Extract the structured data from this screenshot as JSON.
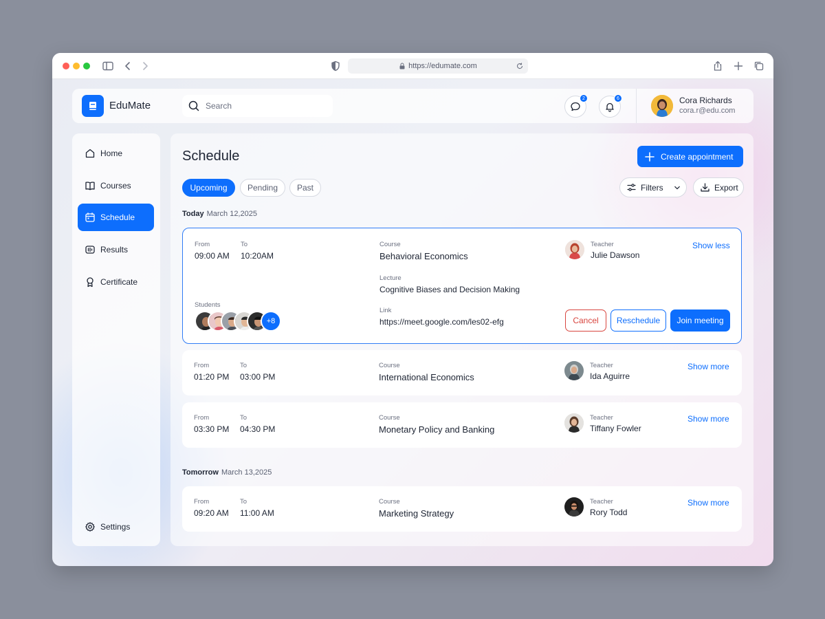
{
  "browser": {
    "url": "https://edumate.com"
  },
  "header": {
    "brand": "EduMate",
    "search_placeholder": "Search",
    "messages_badge": "2",
    "notifications_badge": "6",
    "user": {
      "name": "Cora Richards",
      "email": "cora.r@edu.com"
    }
  },
  "sidebar": {
    "items": [
      {
        "label": "Home",
        "icon": "home-icon",
        "active": false
      },
      {
        "label": "Courses",
        "icon": "book-icon",
        "active": false
      },
      {
        "label": "Schedule",
        "icon": "calendar-icon",
        "active": true
      },
      {
        "label": "Results",
        "icon": "results-icon",
        "active": false
      },
      {
        "label": "Certificate",
        "icon": "certificate-icon",
        "active": false
      }
    ],
    "settings_label": "Settings"
  },
  "main": {
    "title": "Schedule",
    "create_label": "Create appointment",
    "tabs": [
      {
        "label": "Upcoming",
        "active": true
      },
      {
        "label": "Pending",
        "active": false
      },
      {
        "label": "Past",
        "active": false
      }
    ],
    "filters_label": "Filters",
    "export_label": "Export"
  },
  "labels": {
    "from": "From",
    "to": "To",
    "course": "Course",
    "teacher": "Teacher",
    "lecture": "Lecture",
    "link": "Link",
    "students": "Students",
    "show_less": "Show less",
    "show_more": "Show more",
    "cancel": "Cancel",
    "reschedule": "Reschedule",
    "join": "Join meeting"
  },
  "days": [
    {
      "label": "Today",
      "date": "March 12,2025",
      "lessons": [
        {
          "from": "09:00 AM",
          "to": "10:20AM",
          "course": "Behavioral Economics",
          "teacher": "Julie Dawson",
          "lecture": "Cognitive Biases and Decision Making",
          "link": "https://meet.google.com/les02-efg",
          "students_more": "+8",
          "expanded": true
        },
        {
          "from": "01:20 PM",
          "to": "03:00 PM",
          "course": "International Economics",
          "teacher": "Ida Aguirre",
          "expanded": false
        },
        {
          "from": "03:30 PM",
          "to": "04:30 PM",
          "course": "Monetary Policy and Banking",
          "teacher": "Tiffany Fowler",
          "expanded": false
        }
      ]
    },
    {
      "label": "Tomorrow",
      "date": "March 13,2025",
      "lessons": [
        {
          "from": "09:20 AM",
          "to": "11:00 AM",
          "course": "Marketing Strategy",
          "teacher": "Rory Todd",
          "expanded": false
        }
      ]
    }
  ],
  "colors": {
    "accent": "#0d6efd",
    "danger": "#d8453e"
  }
}
